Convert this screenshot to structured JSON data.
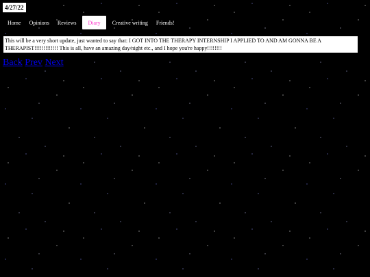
{
  "date": "4/27/22",
  "nav": {
    "items": [
      {
        "label": "Home"
      },
      {
        "label": "Opinions"
      },
      {
        "label": "Reviews"
      },
      {
        "label": "Diary"
      },
      {
        "label": "Creative writing"
      },
      {
        "label": "Friends!"
      }
    ],
    "active_label": "Diary"
  },
  "post": {
    "text": "This will be a very short update, just wanted to say that: I GOT INTO THE THERAPY INTERNSHIP I APPLIED TO AND AM GONNA BE A THERAPIST!!!!!!!!!!!!! This is all, have an amazing day/night etc., and I hope you're happy!!!!!!!!"
  },
  "pager": {
    "back": "Back",
    "prev": "Prev",
    "next": "Next"
  },
  "colors": {
    "background": "#000000",
    "active_nav_text": "#ff33cc",
    "link": "#0000ee"
  }
}
